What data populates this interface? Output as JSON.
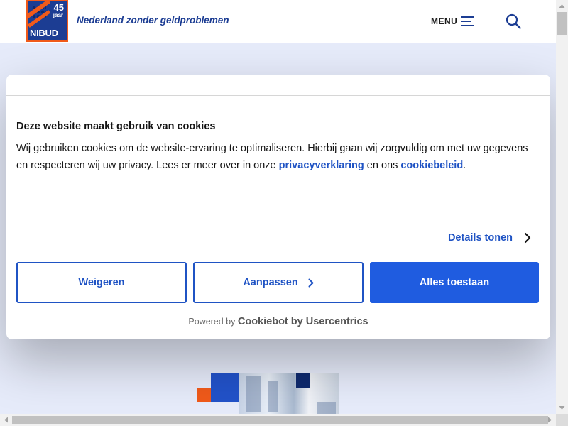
{
  "header": {
    "logo": {
      "number": "45",
      "jaar": "jaar",
      "name": "NIBUD"
    },
    "tagline": "Nederland zonder geldproblemen",
    "menu_label": "MENU",
    "menu_icon": "hamburger-icon",
    "search_icon": "search-icon"
  },
  "cookie_dialog": {
    "title": "Deze website maakt gebruik van cookies",
    "body_part1": "Wij gebruiken cookies om de website-ervaring te optimaliseren. Hierbij gaan wij zorgvuldig om met uw gegevens en respecteren wij uw privacy. Lees er meer over in onze ",
    "privacy_link": "privacyverklaring",
    "body_part2": " en ons ",
    "cookie_link": "cookiebeleid",
    "body_part3": ".",
    "details_label": "Details tonen",
    "buttons": {
      "reject": "Weigeren",
      "customize": "Aanpassen",
      "accept": "Alles toestaan"
    },
    "powered_prefix": "Powered by",
    "powered_brand": "Cookiebot by Usercentrics"
  },
  "colors": {
    "brand_blue": "#1c3d93",
    "link_blue": "#1f53c4",
    "button_blue": "#1f5ce0",
    "accent_orange": "#f05a1a",
    "page_background": "#e6ebfa"
  }
}
